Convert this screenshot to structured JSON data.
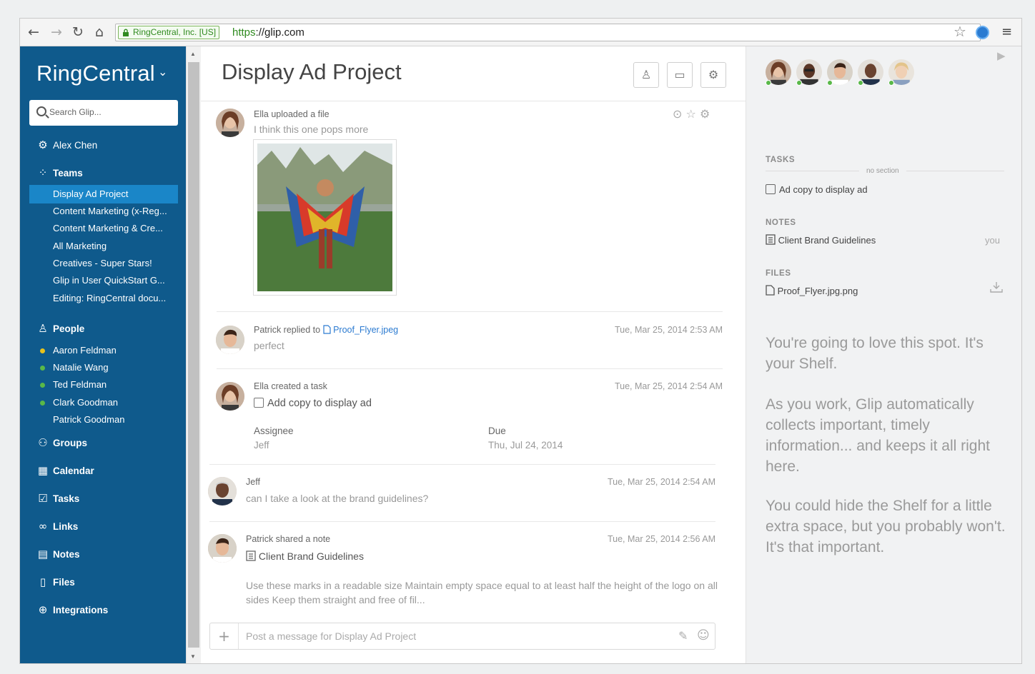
{
  "browser": {
    "secure_label": "RingCentral, Inc. [US]",
    "url_scheme": "https",
    "url_rest": "://glip.com"
  },
  "sidebar": {
    "brand": "RingCentral",
    "search_placeholder": "Search Glip...",
    "user": "Alex Chen",
    "teams_label": "Teams",
    "teams": [
      "Display Ad Project",
      "Content Marketing (x-Reg...",
      "Content Marketing & Cre...",
      "All Marketing",
      "Creatives - Super Stars!",
      "Glip in User QuickStart G...",
      "Editing: RingCentral docu..."
    ],
    "people_label": "People",
    "people": [
      {
        "name": "Aaron Feldman",
        "status_color": "#e8c21c"
      },
      {
        "name": "Natalie Wang",
        "status_color": "#59b848"
      },
      {
        "name": "Ted Feldman",
        "status_color": "#59b848"
      },
      {
        "name": "Clark Goodman",
        "status_color": "#59b848"
      },
      {
        "name": "Patrick Goodman",
        "status_color": null
      }
    ],
    "nav": {
      "groups": "Groups",
      "calendar": "Calendar",
      "tasks": "Tasks",
      "links": "Links",
      "notes": "Notes",
      "files": "Files",
      "integrations": "Integrations"
    },
    "bg_color": "#0f5a8c",
    "active_color": "#1a86c8"
  },
  "main": {
    "title": "Display Ad Project",
    "posts": [
      {
        "meta": "Ella uploaded a file",
        "body": "I think this one pops more"
      },
      {
        "meta_prefix": "Patrick replied to",
        "link": "Proof_Flyer.jpeg",
        "time": "Tue, Mar 25, 2014 2:53 AM",
        "body": "perfect"
      },
      {
        "meta": "Ella created a task",
        "time": "Tue, Mar 25, 2014 2:54 AM",
        "task": "Add copy to display ad",
        "assignee_label": "Assignee",
        "assignee": "Jeff",
        "due_label": "Due",
        "due": "Thu, Jul 24, 2014"
      },
      {
        "meta": "Jeff",
        "time": "Tue, Mar 25, 2014 2:54 AM",
        "body": "can I take a look at the brand guidelines?"
      },
      {
        "meta": "Patrick shared a note",
        "time": "Tue, Mar 25, 2014 2:56 AM",
        "note_title": "Client Brand Guidelines",
        "body": "Use these marks in a readable size Maintain empty space equal to at least half the height of the logo on all sides Keep them straight and free of fil..."
      }
    ],
    "compose_placeholder": "Post a message for Display Ad Project"
  },
  "shelf": {
    "tasks_head": "TASKS",
    "no_section": "no section",
    "task": "Ad copy to display ad",
    "notes_head": "NOTES",
    "note": "Client Brand Guidelines",
    "note_owner": "you",
    "files_head": "FILES",
    "file": "Proof_Flyer.jpg.png",
    "p1": "You're going to love this spot. It's your Shelf.",
    "p2": "As you work, Glip automatically collects important, timely information... and keeps it all right here.",
    "p3": "You could hide the Shelf for a little extra space, but you probably won't. It's that important."
  }
}
